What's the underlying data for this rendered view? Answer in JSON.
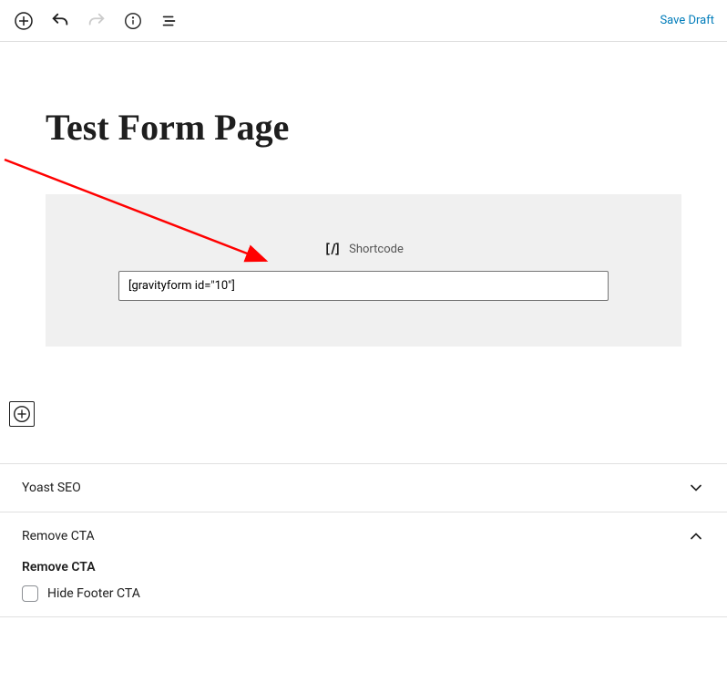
{
  "toolbar": {
    "save_draft_label": "Save Draft"
  },
  "page": {
    "title": "Test Form Page"
  },
  "shortcode": {
    "label": "Shortcode",
    "value": "[gravityform id=\"10\"]"
  },
  "panels": {
    "yoast": {
      "title": "Yoast SEO"
    },
    "remove_cta": {
      "title": "Remove CTA",
      "body_title": "Remove CTA",
      "checkbox_label": "Hide Footer CTA",
      "checked": false
    }
  }
}
